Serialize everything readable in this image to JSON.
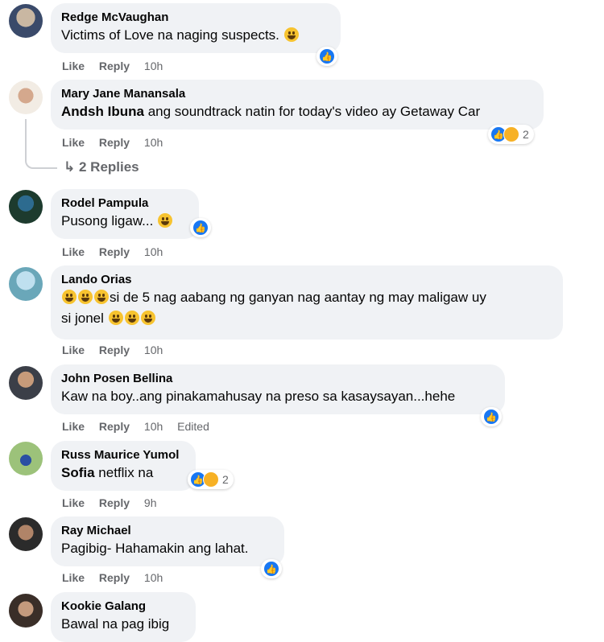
{
  "actions": {
    "like": "Like",
    "reply": "Reply"
  },
  "comments": [
    {
      "author": "Redge McVaughan",
      "mention": "",
      "text": "Victims of Love na naging suspects.",
      "time": "10h"
    },
    {
      "author": "Mary Jane Manansala",
      "mention": "Andsh Ibuna",
      "text": "ang soundtrack natin for today's video ay Getaway Car",
      "time": "10h",
      "reaction_count": "2"
    },
    {
      "author": "Rodel Pampula",
      "mention": "",
      "text": "Pusong ligaw...",
      "time": "10h"
    },
    {
      "author": "Lando Orias",
      "mention": "",
      "text_line1": "si de 5 nag aabang ng ganyan nag aantay ng may maligaw uy",
      "text_line2": "si jonel",
      "time": "10h"
    },
    {
      "author": "John Posen Bellina",
      "mention": "",
      "text": "Kaw na boy..ang pinakamahusay na preso sa kasaysayan...hehe",
      "time": "10h",
      "edited": "Edited"
    },
    {
      "author": "Russ Maurice Yumol",
      "mention": "Sofia",
      "text": "netflix na",
      "time": "9h",
      "reaction_count": "2"
    },
    {
      "author": "Ray Michael",
      "mention": "",
      "text": "Pagibig- Hahamakin ang lahat.",
      "time": "10h"
    },
    {
      "author": "Kookie Galang",
      "mention": "",
      "text": "Bawal na pag ibig"
    }
  ],
  "replies_label": "2 Replies",
  "icons": {
    "like": "like-reaction-icon",
    "haha": "haha-reaction-icon",
    "reply_arrow": "reply-arrow-icon"
  },
  "colors": {
    "bubble": "#f0f2f5",
    "like_blue": "#1877f2",
    "haha_yellow": "#f7b125",
    "meta_gray": "#65676b"
  }
}
